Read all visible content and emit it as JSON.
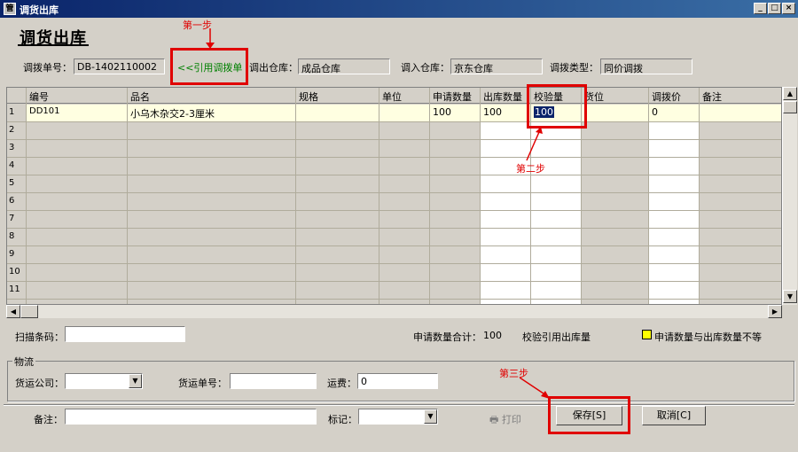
{
  "window": {
    "title": "调货出库",
    "icon": "app-icon"
  },
  "page_title": "调货出库",
  "header": {
    "order_no_label": "调拨单号：",
    "order_no": "DB-1402110002",
    "ref_link": "<<引用调拨单",
    "out_wh_label": "调出仓库：",
    "out_wh": "成品仓库",
    "in_wh_label": "调入仓库：",
    "in_wh": "京东仓库",
    "type_label": "调拨类型：",
    "type": "同价调拨"
  },
  "annotations": {
    "step1": "第一步",
    "step2": "第二步",
    "step3": "第三步"
  },
  "grid": {
    "columns": [
      "编号",
      "品名",
      "规格",
      "单位",
      "申请数量",
      "出库数量",
      "校验量",
      "货位",
      "调拨价",
      "备注"
    ],
    "row_numbers": [
      "1",
      "2",
      "3",
      "4",
      "5",
      "6",
      "7",
      "8",
      "9",
      "10",
      "11"
    ],
    "row1": {
      "code": "DD101",
      "name": "小乌木杂交2-3厘米",
      "spec": "",
      "unit": "",
      "req_qty": "100",
      "out_qty": "100",
      "check_qty": "100",
      "location": "",
      "price": "0",
      "remark": ""
    }
  },
  "scan": {
    "label": "扫描条码："
  },
  "summary": {
    "total_label": "申请数量合计：",
    "total": "100",
    "verify": "校验引用出库量",
    "legend": "申请数量与出库数量不等"
  },
  "logistics": {
    "legend": "物流",
    "company_label": "货运公司：",
    "waybill_label": "货运单号：",
    "freight_label": "运费：",
    "freight": "0"
  },
  "footer": {
    "remark_label": "备注：",
    "mark_label": "标记：",
    "print": "打印",
    "save": "保存[S]",
    "cancel": "取消[C]"
  }
}
